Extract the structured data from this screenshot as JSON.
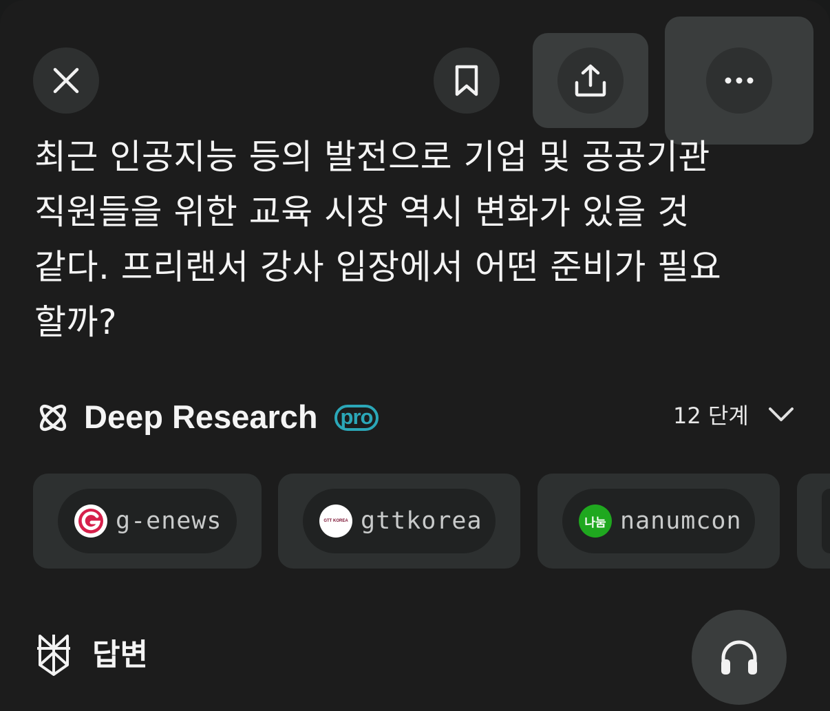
{
  "top_bar": {
    "close_icon": "close-icon",
    "bookmark_icon": "bookmark-icon",
    "share_icon": "share-icon",
    "more_icon": "more-horizontal-icon"
  },
  "question": {
    "lines": [
      "최근 인공지능 등의 발전으로 기업 및 공공기관",
      "직원들을 위한 교육 시장 역시 변화가 있을 것",
      "같다. 프리랜서 강사 입장에서 어떤 준비가 필요",
      "할까?"
    ]
  },
  "research": {
    "icon": "atom-icon",
    "label": "Deep Research",
    "badge": "pro",
    "steps": "12 단계",
    "expand_icon": "chevron-down-icon",
    "accent_color": "#2ba7b8"
  },
  "sources": [
    {
      "name": "g-enews",
      "favicon": "g-enews-logo",
      "favicon_color": "#d6204b"
    },
    {
      "name": "gttkorea",
      "favicon": "gttkorea-logo",
      "favicon_text": "GTT KOREA",
      "favicon_color": "#ffffff"
    },
    {
      "name": "nanumcon",
      "favicon": "nanumcon-logo",
      "favicon_text": "나눔",
      "favicon_color": "#1fa81f"
    }
  ],
  "answer": {
    "icon": "perplexity-logo-icon",
    "label": "답변"
  },
  "audio": {
    "icon": "headphones-icon"
  }
}
